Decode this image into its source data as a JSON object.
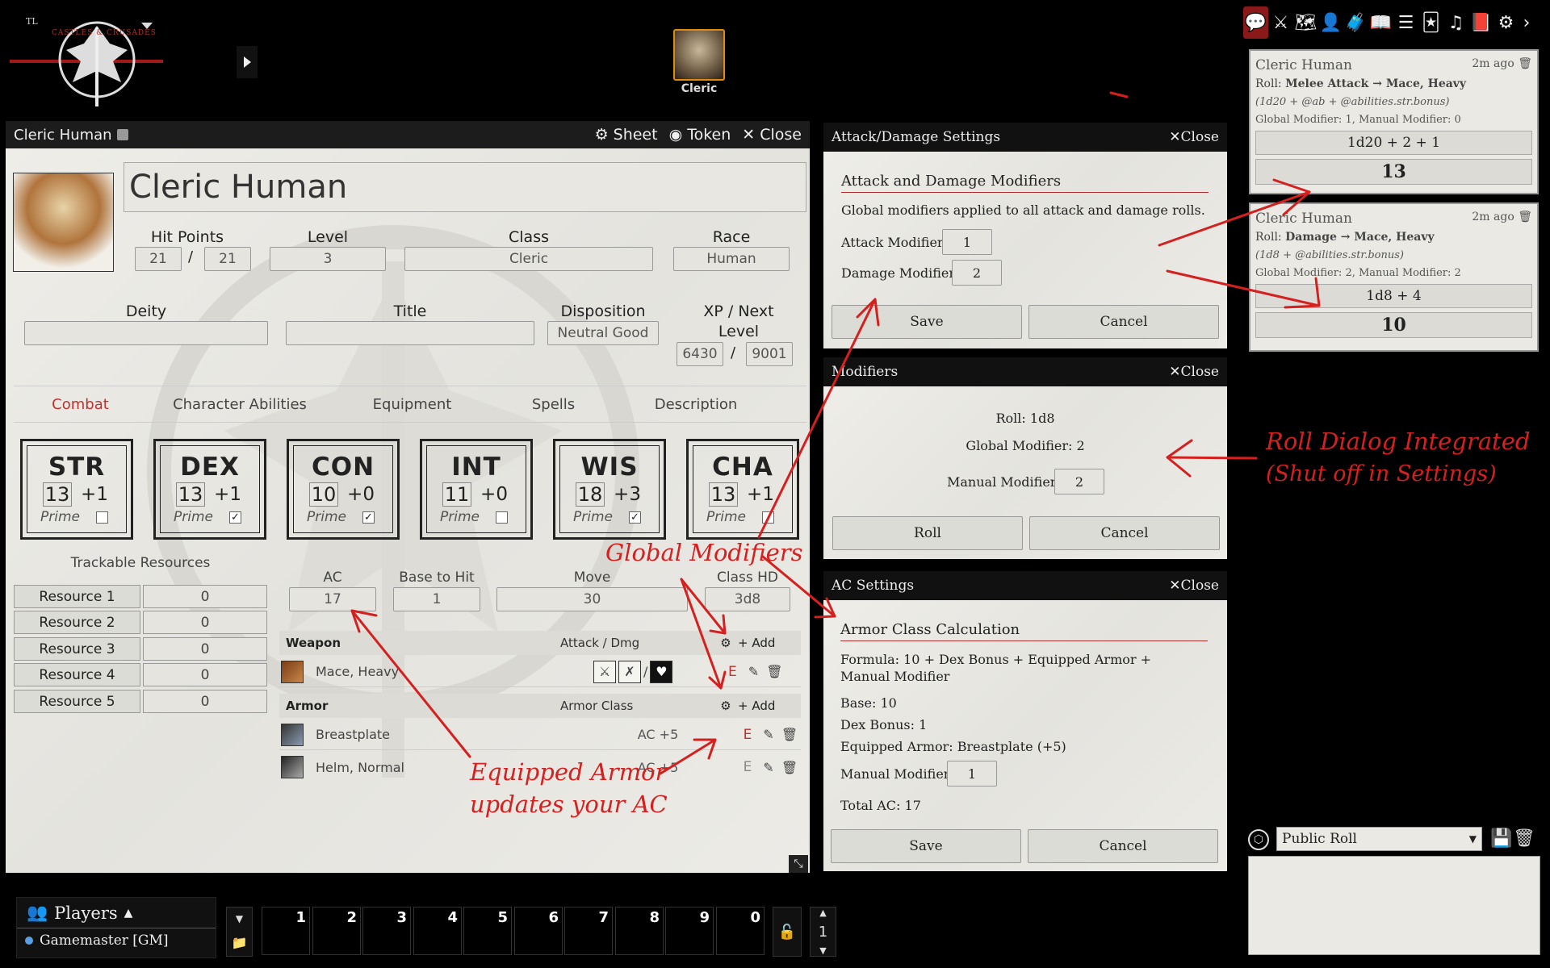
{
  "app": {
    "logo_text": "CASTLES & CRUSADES"
  },
  "token": {
    "label": "Cleric"
  },
  "sheet": {
    "window_title": "Cleric Human",
    "buttons": {
      "sheet": "Sheet",
      "token": "Token",
      "close": "Close"
    },
    "name": "Cleric Human",
    "hit_points": {
      "label": "Hit Points",
      "current": "21",
      "max": "21",
      "sep": "/"
    },
    "level": {
      "label": "Level",
      "value": "3"
    },
    "class": {
      "label": "Class",
      "value": "Cleric"
    },
    "race": {
      "label": "Race",
      "value": "Human"
    },
    "deity": {
      "label": "Deity",
      "value": ""
    },
    "title": {
      "label": "Title",
      "value": ""
    },
    "disposition": {
      "label": "Disposition",
      "value": "Neutral Good"
    },
    "xp": {
      "label1": "XP / Next",
      "label2": "Level",
      "current": "6430",
      "next": "9001",
      "sep": "/"
    },
    "tabs": [
      "Combat",
      "Character Abilities",
      "Equipment",
      "Spells",
      "Description"
    ],
    "abilities": [
      {
        "name": "STR",
        "score": "13",
        "mod": "+1",
        "prime": false
      },
      {
        "name": "DEX",
        "score": "13",
        "mod": "+1",
        "prime": true
      },
      {
        "name": "CON",
        "score": "10",
        "mod": "+0",
        "prime": true
      },
      {
        "name": "INT",
        "score": "11",
        "mod": "+0",
        "prime": false
      },
      {
        "name": "WIS",
        "score": "18",
        "mod": "+3",
        "prime": true
      },
      {
        "name": "CHA",
        "score": "13",
        "mod": "+1",
        "prime": false
      }
    ],
    "prime_label": "Prime",
    "trackable": {
      "label": "Trackable Resources",
      "items": [
        {
          "name": "Resource 1",
          "value": "0"
        },
        {
          "name": "Resource 2",
          "value": "0"
        },
        {
          "name": "Resource 3",
          "value": "0"
        },
        {
          "name": "Resource 4",
          "value": "0"
        },
        {
          "name": "Resource 5",
          "value": "0"
        }
      ]
    },
    "ac": {
      "label": "AC",
      "value": "17"
    },
    "bth": {
      "label": "Base to Hit",
      "value": "1"
    },
    "move": {
      "label": "Move",
      "value": "30"
    },
    "hd": {
      "label": "Class HD",
      "value": "3d8"
    },
    "weapons": {
      "header": "Weapon",
      "col": "Attack / Dmg",
      "add": "Add",
      "items": [
        {
          "name": "Mace, Heavy",
          "equip": "E"
        }
      ]
    },
    "armor": {
      "header": "Armor",
      "col": "Armor Class",
      "add": "Add",
      "items": [
        {
          "name": "Breastplate",
          "ac": "AC +5",
          "equip": "E"
        },
        {
          "name": "Helm, Normal",
          "ac": "AC +5",
          "equip": "E"
        }
      ]
    }
  },
  "attack_dialog": {
    "title": "Attack/Damage Settings",
    "close": "Close",
    "heading": "Attack and Damage Modifiers",
    "desc": "Global modifiers applied to all attack and damage rolls.",
    "attack_label": "Attack Modifier:",
    "attack_value": "1",
    "damage_label": "Damage Modifier:",
    "damage_value": "2",
    "save": "Save",
    "cancel": "Cancel"
  },
  "modifiers_dialog": {
    "title": "Modifiers",
    "close": "Close",
    "roll": "Roll: 1d8",
    "global": "Global Modifier: 2",
    "manual_label": "Manual Modifier:",
    "manual_value": "2",
    "roll_btn": "Roll",
    "cancel": "Cancel"
  },
  "ac_dialog": {
    "title": "AC Settings",
    "close": "Close",
    "heading": "Armor Class Calculation",
    "formula": "Formula: 10 + Dex Bonus + Equipped Armor + Manual Modifier",
    "base": "Base: 10",
    "dex": "Dex Bonus: 1",
    "equipped": "Equipped Armor: Breastplate (+5)",
    "manual_label": "Manual Modifier:",
    "manual_value": "1",
    "total": "Total AC: 17",
    "save": "Save",
    "cancel": "Cancel"
  },
  "chat": {
    "messages": [
      {
        "speaker": "Cleric Human",
        "time": "2m ago",
        "roll_prefix": "Roll:",
        "roll": "Melee Attack → Mace, Heavy",
        "formula": "(1d20 + @ab + @abilities.str.bonus)",
        "mods": "Global Modifier: 1, Manual Modifier: 0",
        "expr": "1d20 + 2 + 1",
        "total": "13"
      },
      {
        "speaker": "Cleric Human",
        "time": "2m ago",
        "roll_prefix": "Roll:",
        "roll": "Damage → Mace, Heavy",
        "formula": "(1d8 + @abilities.str.bonus)",
        "mods": "Global Modifier: 2, Manual Modifier: 2",
        "expr": "1d8 + 4",
        "total": "10"
      }
    ],
    "roll_mode": "Public Roll"
  },
  "players": {
    "title": "Players",
    "items": [
      "Gamemaster [GM]"
    ]
  },
  "hotbar": {
    "slots": [
      "1",
      "2",
      "3",
      "4",
      "5",
      "6",
      "7",
      "8",
      "9",
      "0"
    ],
    "page": "1"
  },
  "annotations": {
    "global_modifiers": "Global Modifiers",
    "roll_dialog1": "Roll Dialog Integrated",
    "roll_dialog2": "(Shut off in Settings)",
    "equipped1": "Equipped Armor",
    "equipped2": "updates your AC"
  },
  "colors": {
    "accent_red": "#d52020",
    "tab_active": "#c03030",
    "dialog_bg": "#eae9e4",
    "titlebar": "#111111"
  }
}
